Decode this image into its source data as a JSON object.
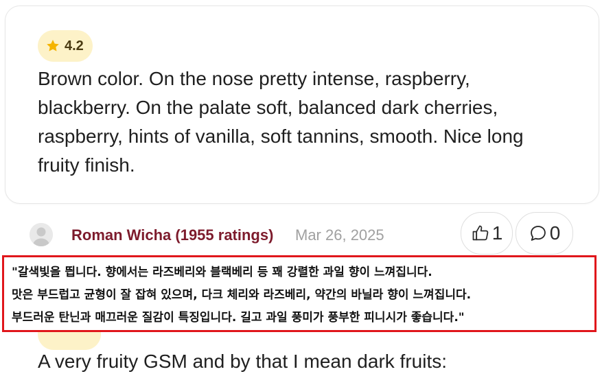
{
  "review": {
    "rating": "4.2",
    "text": "Brown color. On the nose pretty intense, raspberry, blackberry. On the palate soft, balanced dark cherries, raspberry, hints of vanilla, soft tannins, smooth. Nice long fruity finish."
  },
  "next_review": {
    "author": "Roman Wicha (1955 ratings)",
    "date": "Mar 26, 2025",
    "likes": "1",
    "comments": "0",
    "text_preview": "A very fruity GSM and by that I mean dark fruits:"
  },
  "translation": {
    "lines": [
      "\"갈색빛을 띕니다. 향에서는 라즈베리와 블랙베리 등 꽤 강렬한 과일 향이 느껴집니다.",
      "맛은 부드럽고 균형이 잘 잡혀 있으며, 다크 체리와 라즈베리, 약간의 바닐라 향이 느껴집니다.",
      "부드러운 탄닌과 매끄러운 질감이 특징입니다. 길고 과일 풍미가 풍부한 피니시가 좋습니다.\""
    ]
  },
  "icons": {
    "rating": "star-icon",
    "like": "thumbs-up-icon",
    "comment": "comment-bubble-icon",
    "avatar": "user-avatar-icon"
  },
  "colors": {
    "star": "#f5b400",
    "badge_bg": "#fdf2c8",
    "author": "#7d1b2c",
    "highlight_border": "#e0161b"
  }
}
